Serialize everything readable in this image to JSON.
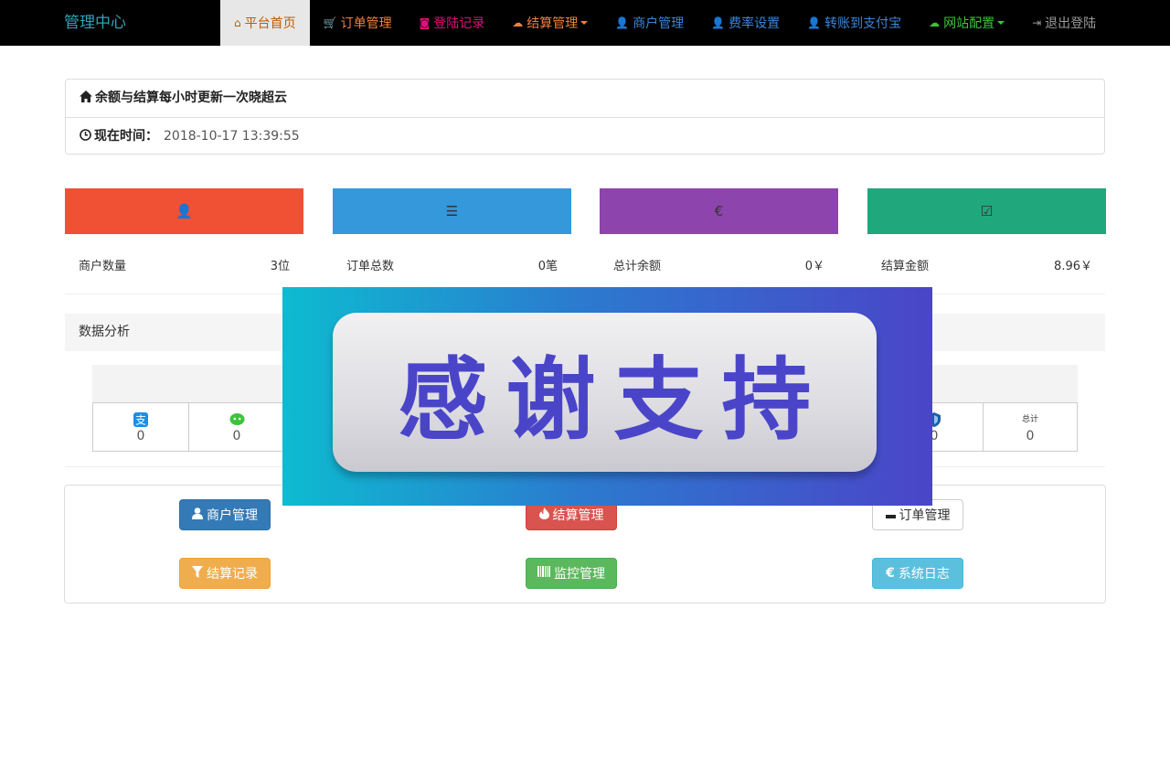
{
  "brand": "管理中心",
  "nav": [
    {
      "name": "nav-home",
      "icon": "home-icon",
      "glyph": "⌂",
      "label": "平台首页",
      "color": "#c05a00",
      "active": true,
      "caret": false
    },
    {
      "name": "nav-orders",
      "icon": "cart-icon",
      "glyph": "🛒",
      "label": "订单管理",
      "color": "#f0803c",
      "active": false,
      "caret": false
    },
    {
      "name": "nav-login-records",
      "icon": "camera-icon",
      "glyph": "◙",
      "label": "登陆记录",
      "color": "#e0117d",
      "active": false,
      "caret": false
    },
    {
      "name": "nav-settlement",
      "icon": "cloud-icon",
      "glyph": "☁",
      "label": "结算管理",
      "color": "#f0803c",
      "active": false,
      "caret": true
    },
    {
      "name": "nav-merchants",
      "icon": "user-icon",
      "glyph": "👤",
      "label": "商户管理",
      "color": "#3a85d8",
      "active": false,
      "caret": false
    },
    {
      "name": "nav-rates",
      "icon": "user-icon",
      "glyph": "👤",
      "label": "费率设置",
      "color": "#3a85d8",
      "active": false,
      "caret": false
    },
    {
      "name": "nav-transfer-alipay",
      "icon": "user-icon",
      "glyph": "👤",
      "label": "转账到支付宝",
      "color": "#3a85d8",
      "active": false,
      "caret": false
    },
    {
      "name": "nav-site-config",
      "icon": "cloud-icon",
      "glyph": "☁",
      "label": "网站配置",
      "color": "#3cc33c",
      "active": false,
      "caret": true
    },
    {
      "name": "nav-logout",
      "icon": "logout-icon",
      "glyph": "⇥",
      "label": "退出登陆",
      "color": "#999999",
      "active": false,
      "caret": false
    }
  ],
  "info": {
    "notice": "余额与结算每小时更新一次晓超云",
    "time_label": "现在时间：",
    "time_value": "2018-10-17 13:39:55"
  },
  "stats": [
    {
      "name": "stat-merchants",
      "icon": "user-icon",
      "glyph": "👤",
      "color": "#f05034",
      "label": "商户数量",
      "value": "3位"
    },
    {
      "name": "stat-orders",
      "icon": "list-icon",
      "glyph": "☰",
      "color": "#3498db",
      "label": "订单总数",
      "value": "0笔"
    },
    {
      "name": "stat-balance",
      "icon": "euro-icon",
      "glyph": "€",
      "color": "#8e44ad",
      "label": "总计余额",
      "value": "0￥"
    },
    {
      "name": "stat-settlement",
      "icon": "check-square-icon",
      "glyph": "☑",
      "color": "#20a77b",
      "label": "结算金额",
      "value": "8.96￥"
    }
  ],
  "analysis": {
    "title": "数据分析",
    "cells": [
      {
        "name": "cell-alipay",
        "icon": "alipay-icon",
        "value": "0"
      },
      {
        "name": "cell-wechat",
        "icon": "wechat-icon",
        "value": "0"
      },
      {
        "name": "cell-qq",
        "icon": "shield-icon",
        "value": "0"
      },
      {
        "name": "cell-total",
        "icon": "total-icon",
        "label": "总计",
        "value": "0"
      }
    ]
  },
  "buttons": [
    {
      "name": "merchant-manage-button",
      "icon": "user-icon",
      "glyph": "👤",
      "label": "商户管理",
      "bg": "#337ab7"
    },
    {
      "name": "settlement-manage-button",
      "icon": "fire-icon",
      "glyph": "🔥",
      "label": "结算管理",
      "bg": "#d9534f"
    },
    {
      "name": "order-manage-button",
      "icon": "minus-icon",
      "glyph": "━",
      "label": "订单管理",
      "bg": "#ffffff"
    },
    {
      "name": "settlement-records-button",
      "icon": "filter-icon",
      "glyph": "▼",
      "label": "结算记录",
      "bg": "#f0ad4e"
    },
    {
      "name": "monitor-manage-button",
      "icon": "barcode-icon",
      "glyph": "▥",
      "label": "监控管理",
      "bg": "#5cb85c"
    },
    {
      "name": "system-log-button",
      "icon": "euro-icon",
      "glyph": "€",
      "label": "系统日志",
      "bg": "#5bc0de"
    }
  ],
  "overlay": {
    "text": "感谢支持"
  }
}
